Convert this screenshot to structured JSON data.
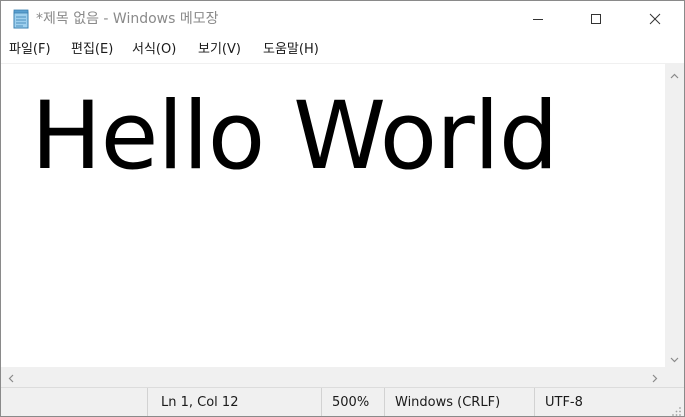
{
  "window": {
    "title": "*제목 없음 - Windows 메모장"
  },
  "menu": {
    "items": [
      {
        "label": "파일(F)"
      },
      {
        "label": "편집(E)"
      },
      {
        "label": "서식(O)"
      },
      {
        "label": "보기(V)"
      },
      {
        "label": "도움말(H)"
      }
    ]
  },
  "editor": {
    "text": "Hello World"
  },
  "status": {
    "position": "Ln 1, Col 12",
    "zoom": "500%",
    "line_ending": "Windows (CRLF)",
    "encoding": "UTF-8"
  },
  "icons": {
    "app": "notepad-icon",
    "minimize": "minimize-icon",
    "maximize": "maximize-icon",
    "close": "close-icon"
  }
}
